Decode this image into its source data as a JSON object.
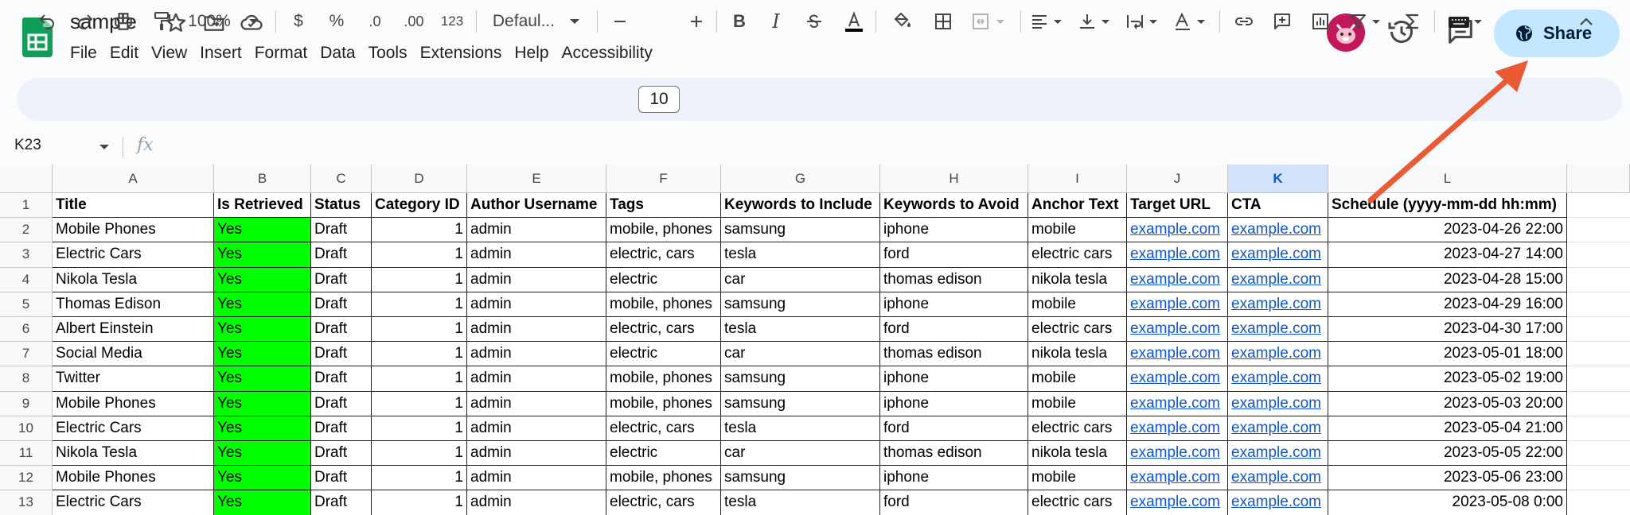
{
  "app": {
    "doc_title": "sample",
    "menus": [
      "File",
      "Edit",
      "View",
      "Insert",
      "Format",
      "Data",
      "Tools",
      "Extensions",
      "Help",
      "Accessibility"
    ],
    "share_label": "Share",
    "colors": {
      "accent": "#0f9d58",
      "share_bg": "#c2e7ff",
      "highlight": "#00ff00",
      "link": "#1155cc",
      "annotation_arrow": "#ea5a34"
    }
  },
  "toolbar": {
    "zoom": "100%",
    "currency": "$",
    "percent": "%",
    "dec_decrease": ".0",
    "dec_increase": ".00",
    "more_formats": "123",
    "font": "Defaul...",
    "font_size": "10"
  },
  "formula": {
    "cell_ref": "K23",
    "fx": "fx",
    "value": ""
  },
  "columns": [
    "A",
    "B",
    "C",
    "D",
    "E",
    "F",
    "G",
    "H",
    "I",
    "J",
    "K",
    "L"
  ],
  "selected_column": "K",
  "row_numbers": [
    "1",
    "2",
    "3",
    "4",
    "5",
    "6",
    "7",
    "8",
    "9",
    "10",
    "11",
    "12",
    "13"
  ],
  "table": {
    "headers": [
      "Title",
      "Is Retrieved",
      "Status",
      "Category ID",
      "Author Username",
      "Tags",
      "Keywords to Include",
      "Keywords to Avoid",
      "Anchor Text",
      "Target URL",
      "CTA",
      "Schedule (yyyy-mm-dd hh:mm)"
    ],
    "rows": [
      [
        "Mobile Phones",
        "Yes",
        "Draft",
        "1",
        "admin",
        "mobile, phones",
        "samsung",
        "iphone",
        "mobile",
        "example.com",
        "example.com",
        "2023-04-26 22:00"
      ],
      [
        "Electric Cars",
        "Yes",
        "Draft",
        "1",
        "admin",
        "electric, cars",
        "tesla",
        "ford",
        "electric cars",
        "example.com",
        "example.com",
        "2023-04-27 14:00"
      ],
      [
        "Nikola Tesla",
        "Yes",
        "Draft",
        "1",
        "admin",
        "electric",
        "car",
        "thomas edison",
        "nikola tesla",
        "example.com",
        "example.com",
        "2023-04-28 15:00"
      ],
      [
        "Thomas Edison",
        "Yes",
        "Draft",
        "1",
        "admin",
        "mobile, phones",
        "samsung",
        "iphone",
        "mobile",
        "example.com",
        "example.com",
        "2023-04-29 16:00"
      ],
      [
        "Albert Einstein",
        "Yes",
        "Draft",
        "1",
        "admin",
        "electric, cars",
        "tesla",
        "ford",
        "electric cars",
        "example.com",
        "example.com",
        "2023-04-30 17:00"
      ],
      [
        "Social Media",
        "Yes",
        "Draft",
        "1",
        "admin",
        "electric",
        "car",
        "thomas edison",
        "nikola tesla",
        "example.com",
        "example.com",
        "2023-05-01 18:00"
      ],
      [
        "Twitter",
        "Yes",
        "Draft",
        "1",
        "admin",
        "mobile, phones",
        "samsung",
        "iphone",
        "mobile",
        "example.com",
        "example.com",
        "2023-05-02 19:00"
      ],
      [
        "Mobile Phones",
        "Yes",
        "Draft",
        "1",
        "admin",
        "mobile, phones",
        "samsung",
        "iphone",
        "mobile",
        "example.com",
        "example.com",
        "2023-05-03 20:00"
      ],
      [
        "Electric Cars",
        "Yes",
        "Draft",
        "1",
        "admin",
        "electric, cars",
        "tesla",
        "ford",
        "electric cars",
        "example.com",
        "example.com",
        "2023-05-04 21:00"
      ],
      [
        "Nikola Tesla",
        "Yes",
        "Draft",
        "1",
        "admin",
        "electric",
        "car",
        "thomas edison",
        "nikola tesla",
        "example.com",
        "example.com",
        "2023-05-05 22:00"
      ],
      [
        "Mobile Phones",
        "Yes",
        "Draft",
        "1",
        "admin",
        "mobile, phones",
        "samsung",
        "iphone",
        "mobile",
        "example.com",
        "example.com",
        "2023-05-06 23:00"
      ],
      [
        "Electric Cars",
        "Yes",
        "Draft",
        "1",
        "admin",
        "electric, cars",
        "tesla",
        "ford",
        "electric cars",
        "example.com",
        "example.com",
        "2023-05-08 0:00"
      ]
    ]
  }
}
